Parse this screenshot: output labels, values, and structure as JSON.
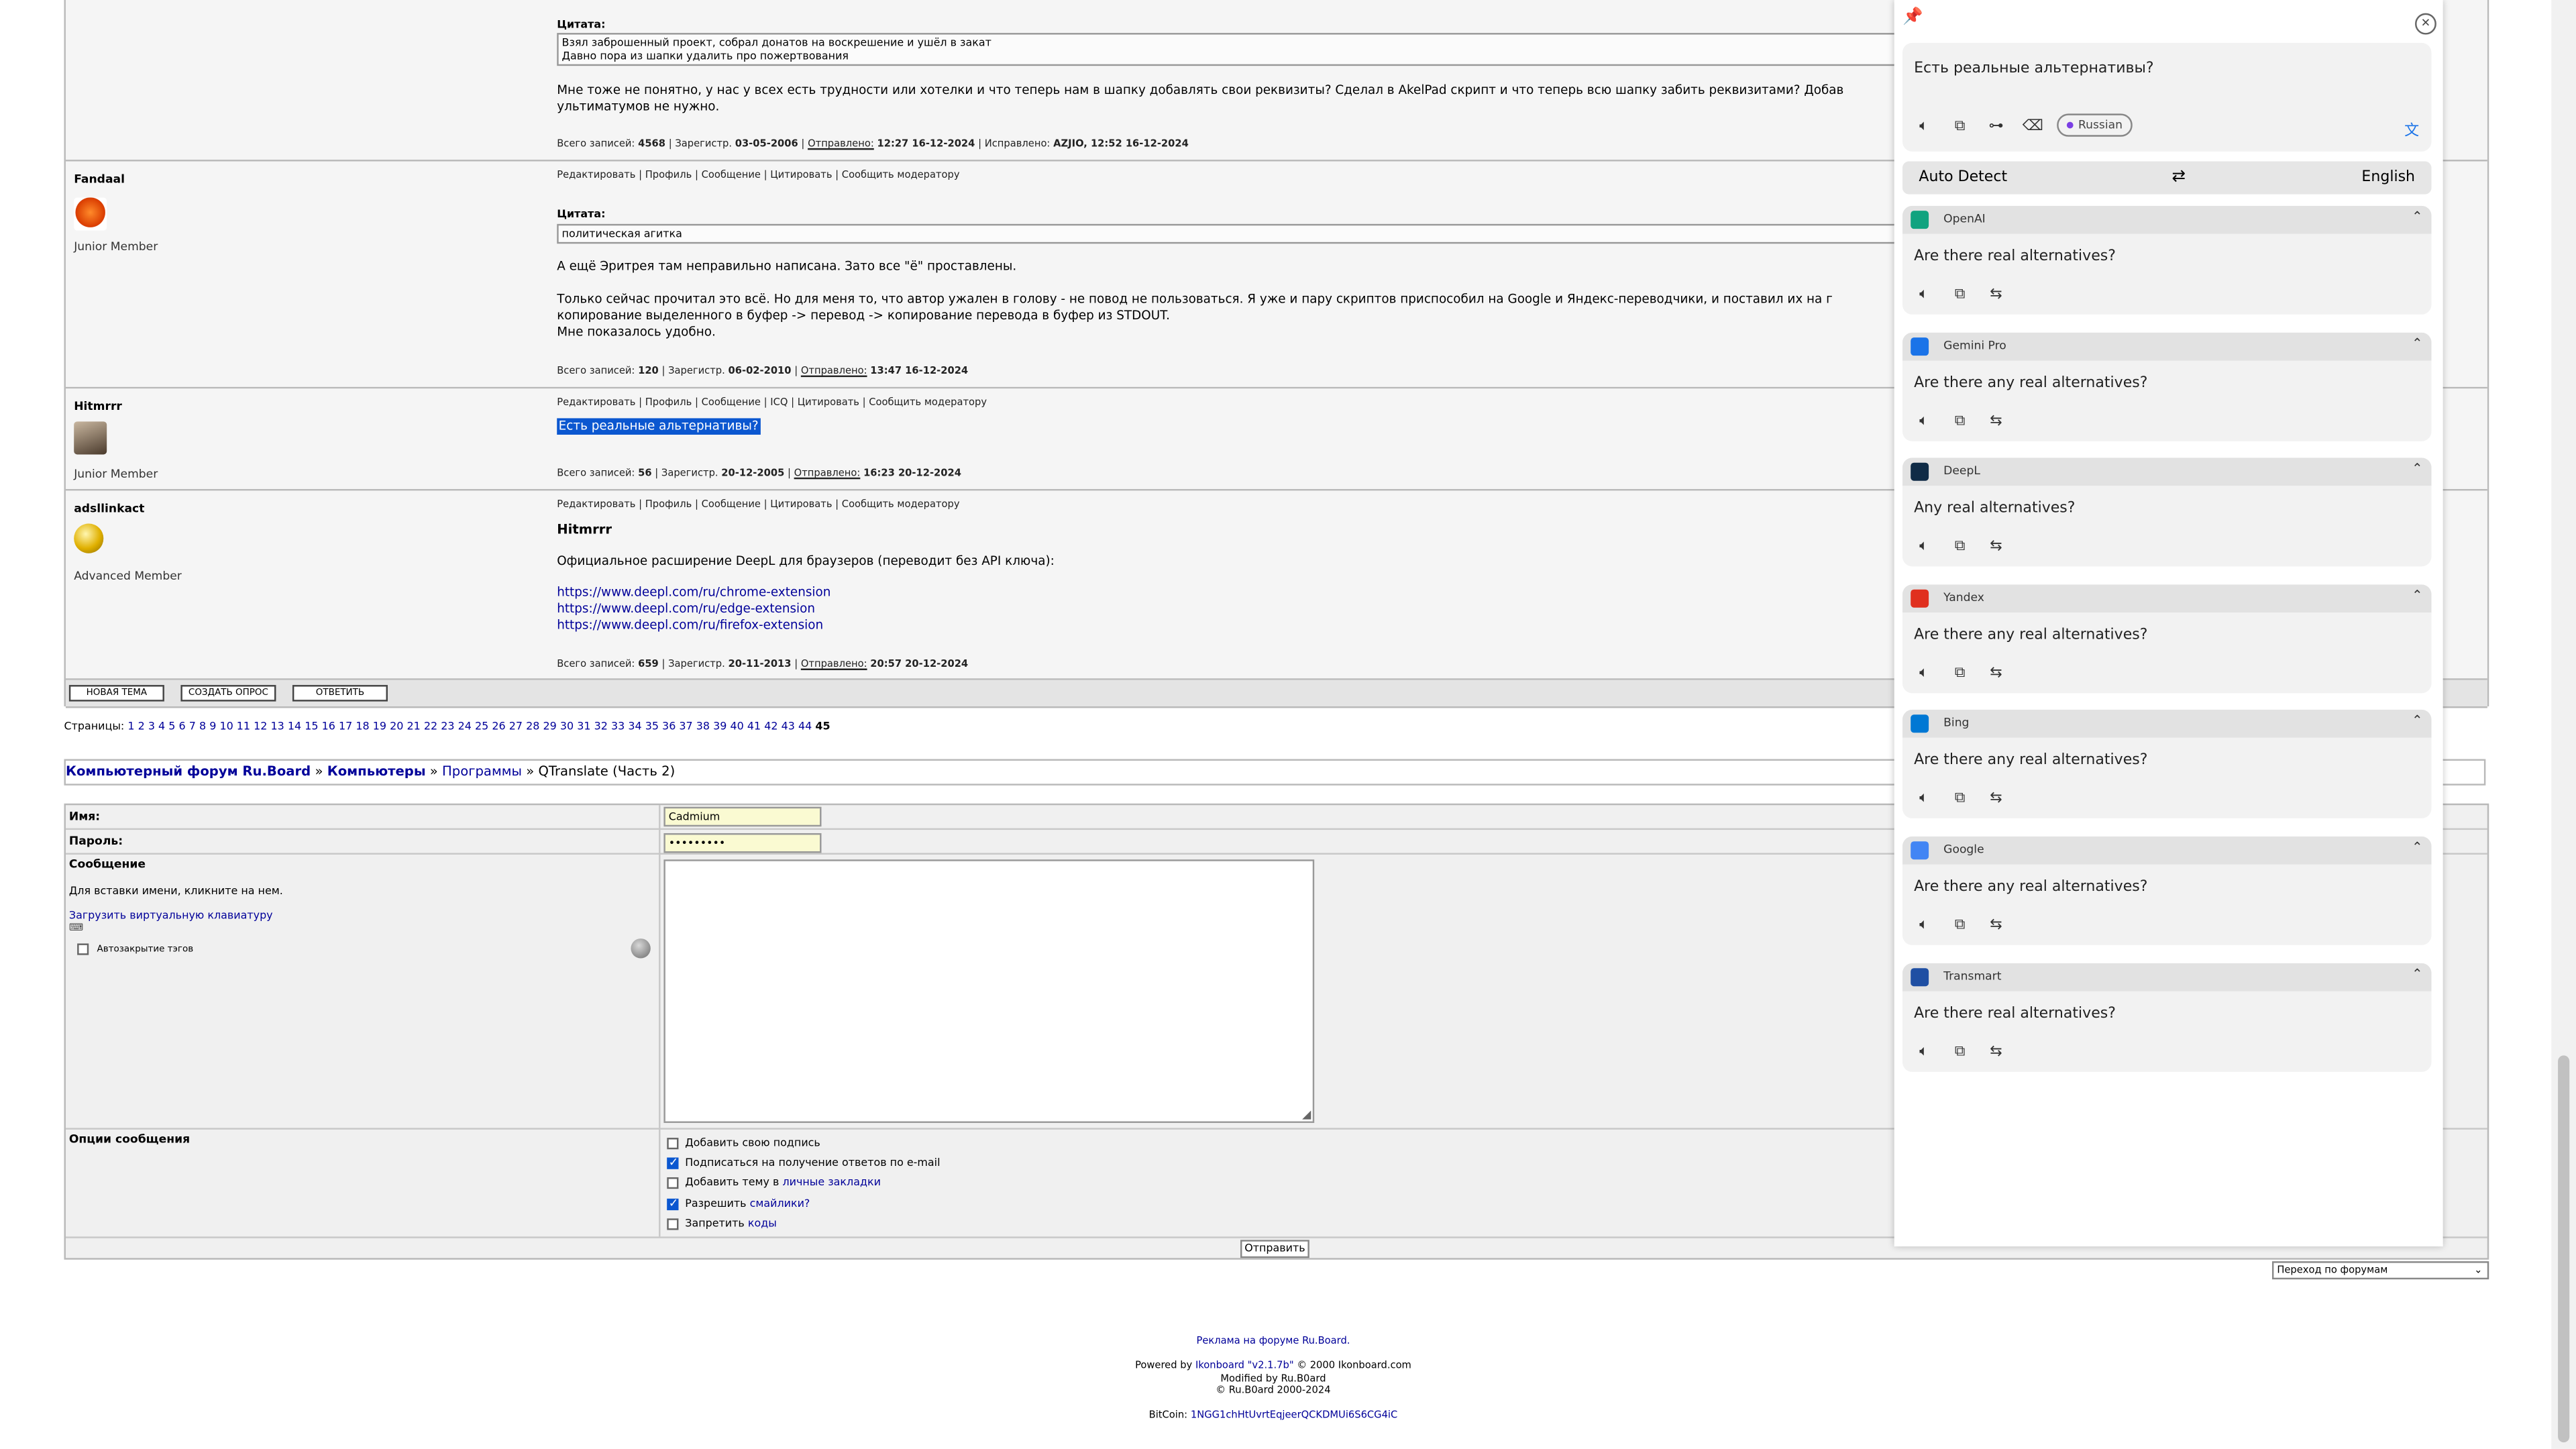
{
  "posts": [
    {
      "quote_label": "Цитата:",
      "quote_lines": [
        "Взял заброшенный проект, собрал донатов на воскрешение и ушёл в закат",
        "Давно пора из шапки удалить про пожертвования"
      ],
      "body": [
        "Мне тоже не понятно, у нас у всех есть трудности или хотелки и что теперь нам в шапку добавлять свои реквизиты? Сделал в AkelPad скрипт и что теперь всю шапку забить реквизитами? Добав",
        "ультиматумов не нужно."
      ],
      "stats": {
        "prefix": "Всего записей:",
        "count": "4568",
        "reg_label": "| Зарегистр.",
        "reg": "03-05-2006",
        "sent_label": "Отправлено:",
        "sent": "12:27 16-12-2024",
        "edit_label": "| Исправлено:",
        "edit": "AZJIO, 12:52 16-12-2024"
      }
    },
    {
      "author": "Fandaal",
      "rank": "Junior Member",
      "actions": "Редактировать | Профиль | Сообщение | Цитировать | Сообщить модератору",
      "quote_label": "Цитата:",
      "quote_lines": [
        "политическая агитка"
      ],
      "body": [
        "А ещё Эритрея там неправильно написана. Зато все \"ё\" проставлены.",
        "",
        "Только сейчас прочитал это всё. Но для меня то, что автор ужален в голову - не повод не пользоваться. Я уже и пару скриптов приспособил на Google и Яндекс-переводчики, и поставил их на г",
        "копирование выделенного в буфер -> перевод -> копирование перевода в буфер из STDOUT.",
        "Мне показалось удобно."
      ],
      "stats": {
        "prefix": "Всего записей:",
        "count": "120",
        "reg_label": "| Зарегистр.",
        "reg": "06-02-2010",
        "sent_label": "Отправлено:",
        "sent": "13:47 16-12-2024"
      }
    },
    {
      "author": "Hitmrrr",
      "rank": "Junior Member",
      "actions": "Редактировать | Профиль | Сообщение | ICQ | Цитировать | Сообщить модератору",
      "selected_text": "Есть реальные альтернативы?",
      "stats": {
        "prefix": "Всего записей:",
        "count": "56",
        "reg_label": "| Зарегистр.",
        "reg": "20-12-2005",
        "sent_label": "Отправлено:",
        "sent": "16:23 20-12-2024"
      }
    },
    {
      "author": "adsllinkact",
      "rank": "Advanced Member",
      "actions": "Редактировать | Профиль | Сообщение | Цитировать | Сообщить модератору",
      "addressee": "Hitmrrr",
      "body": [
        "Официальное расширение DeepL для браузеров (переводит без API ключа):"
      ],
      "links": [
        "https://www.deepl.com/ru/chrome-extension",
        "https://www.deepl.com/ru/edge-extension",
        "https://www.deepl.com/ru/firefox-extension"
      ],
      "stats": {
        "prefix": "Всего записей:",
        "count": "659",
        "reg_label": "| Зарегистр.",
        "reg": "20-11-2013",
        "sent_label": "Отправлено:",
        "sent": "20:57 20-12-2024"
      }
    }
  ],
  "buttons": {
    "new_topic": "НОВАЯ ТЕМА",
    "new_poll": "СОЗДАТЬ ОПРОС",
    "reply": "ОТВЕТИТЬ"
  },
  "pagination": {
    "label": "Страницы:",
    "pages": [
      "1",
      "2",
      "3",
      "4",
      "5",
      "6",
      "7",
      "8",
      "9",
      "10",
      "11",
      "12",
      "13",
      "14",
      "15",
      "16",
      "17",
      "18",
      "19",
      "20",
      "21",
      "22",
      "23",
      "24",
      "25",
      "26",
      "27",
      "28",
      "29",
      "30",
      "31",
      "32",
      "33",
      "34",
      "35",
      "36",
      "37",
      "38",
      "39",
      "40",
      "41",
      "42",
      "43",
      "44"
    ],
    "current": "45"
  },
  "breadcrumb": {
    "forum": "Компьютерный форум Ru.Board",
    "sep": "»",
    "section": "Компьютеры",
    "subsection": "Программы",
    "topic": "QTranslate (Часть 2)"
  },
  "form": {
    "name_label": "Имя:",
    "name_value": "Cadmium",
    "password_label": "Пароль:",
    "password_value": "•••••••••",
    "message_label": "Сообщение",
    "message_hint": "Для вставки имени, кликните на нем.",
    "keyboard_link": "Загрузить виртуальную клавиатуру",
    "autoclose_label": "Автозакрытие тэгов",
    "options_label": "Опции сообщения",
    "options": [
      {
        "text": "Добавить свою подпись",
        "link": "",
        "checked": false
      },
      {
        "text": "Подписаться на получение ответов по e-mail",
        "link": "",
        "checked": true
      },
      {
        "text": "Добавить тему в ",
        "link": "личные закладки",
        "checked": false
      },
      {
        "text": "Разрешить ",
        "link": "смайлики?",
        "checked": true
      },
      {
        "text": "Запретить ",
        "link": "коды",
        "checked": false
      }
    ],
    "submit": "Отправить"
  },
  "jump": "Переход по форумам",
  "footer": {
    "ad": "Реклама на форуме Ru.Board.",
    "powered_prefix": "Powered by",
    "powered_link": "Ikonboard \"v2.1.7b\"",
    "powered_suffix": "© 2000 Ikonboard.com",
    "modified": "Modified by Ru.B0ard",
    "copyright": "© Ru.B0ard 2000-2024",
    "bitcoin_label": "BitCoin:",
    "bitcoin": "1NGG1chHtUvrtEqjeerQCKDMUi6S6CG4iC"
  },
  "translator": {
    "source_text": "Есть реальные альтернативы?",
    "source_lang_chip": "Russian",
    "from_lang": "Auto Detect",
    "to_lang": "English",
    "results": [
      {
        "name": "OpenAI",
        "text": "Are there real alternatives?",
        "color": "#10a37f"
      },
      {
        "name": "Gemini Pro",
        "text": "Are there any real alternatives?",
        "color": "#1a73e8"
      },
      {
        "name": "DeepL",
        "text": "Any real alternatives?",
        "color": "#0f2b46"
      },
      {
        "name": "Yandex",
        "text": "Are there any real alternatives?",
        "color": "#e0301e"
      },
      {
        "name": "Bing",
        "text": "Are there any real alternatives?",
        "color": "#0078d4"
      },
      {
        "name": "Google",
        "text": "Are there any real alternatives?",
        "color": "#4285f4"
      },
      {
        "name": "Transmart",
        "text": "Are there real alternatives?",
        "color": "#1f4fa3"
      }
    ]
  },
  "colors": {
    "link": "#000099",
    "selection": "#0b57d0",
    "accent": "#1a73e8"
  }
}
